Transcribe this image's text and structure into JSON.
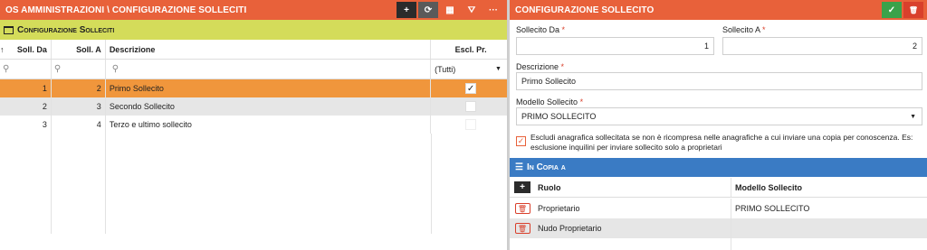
{
  "left": {
    "title": "OS AMMINISTRAZIONI \\ CONFIGURAZIONE SOLLECITI",
    "tools": {
      "add": "+",
      "refresh": "⟳",
      "table": "▦",
      "filter": "⛛",
      "more": "···"
    },
    "section_title": "Configurazione Solleciti",
    "columns": {
      "sort": "↑",
      "da": "Soll. Da",
      "a": "Soll. A",
      "desc": "Descrizione",
      "escl": "Escl. Pr."
    },
    "filter": {
      "search_icon": "⚲",
      "tutti": "(Tutti)"
    },
    "rows": [
      {
        "da": "1",
        "a": "2",
        "desc": "Primo Sollecito",
        "escl": "✓"
      },
      {
        "da": "2",
        "a": "3",
        "desc": "Secondo Sollecito",
        "escl": ""
      },
      {
        "da": "3",
        "a": "4",
        "desc": "Terzo e ultimo sollecito",
        "escl": ""
      }
    ]
  },
  "right": {
    "title": "CONFIGURAZIONE SOLLECITO",
    "tools": {
      "save": "✓",
      "delete": "🗑"
    },
    "fields": {
      "da_label": "Sollecito Da",
      "da_value": "1",
      "a_label": "Sollecito A",
      "a_value": "2",
      "desc_label": "Descrizione",
      "desc_value": "Primo Sollecito",
      "modello_label": "Modello Sollecito",
      "modello_value": "PRIMO SOLLECITO",
      "required": "*"
    },
    "exclude": {
      "checked": "✓",
      "text": "Escludi anagrafica sollecitata se non è ricompresa nelle anagrafiche a cui inviare una copia per conoscenza. Es: esclusione inquilini per inviare sollecito solo a proprietari"
    },
    "copia": {
      "title": "In Copia a",
      "add": "+",
      "col_ruolo": "Ruolo",
      "col_modello": "Modello Sollecito",
      "rows": [
        {
          "ruolo": "Proprietario",
          "modello": "PRIMO SOLLECITO"
        },
        {
          "ruolo": "Nudo Proprietario",
          "modello": ""
        }
      ]
    }
  },
  "colors": {
    "header": "#e8613a",
    "section": "#d4dc5a",
    "selected": "#f0963c",
    "blue": "#3a7bc4"
  }
}
